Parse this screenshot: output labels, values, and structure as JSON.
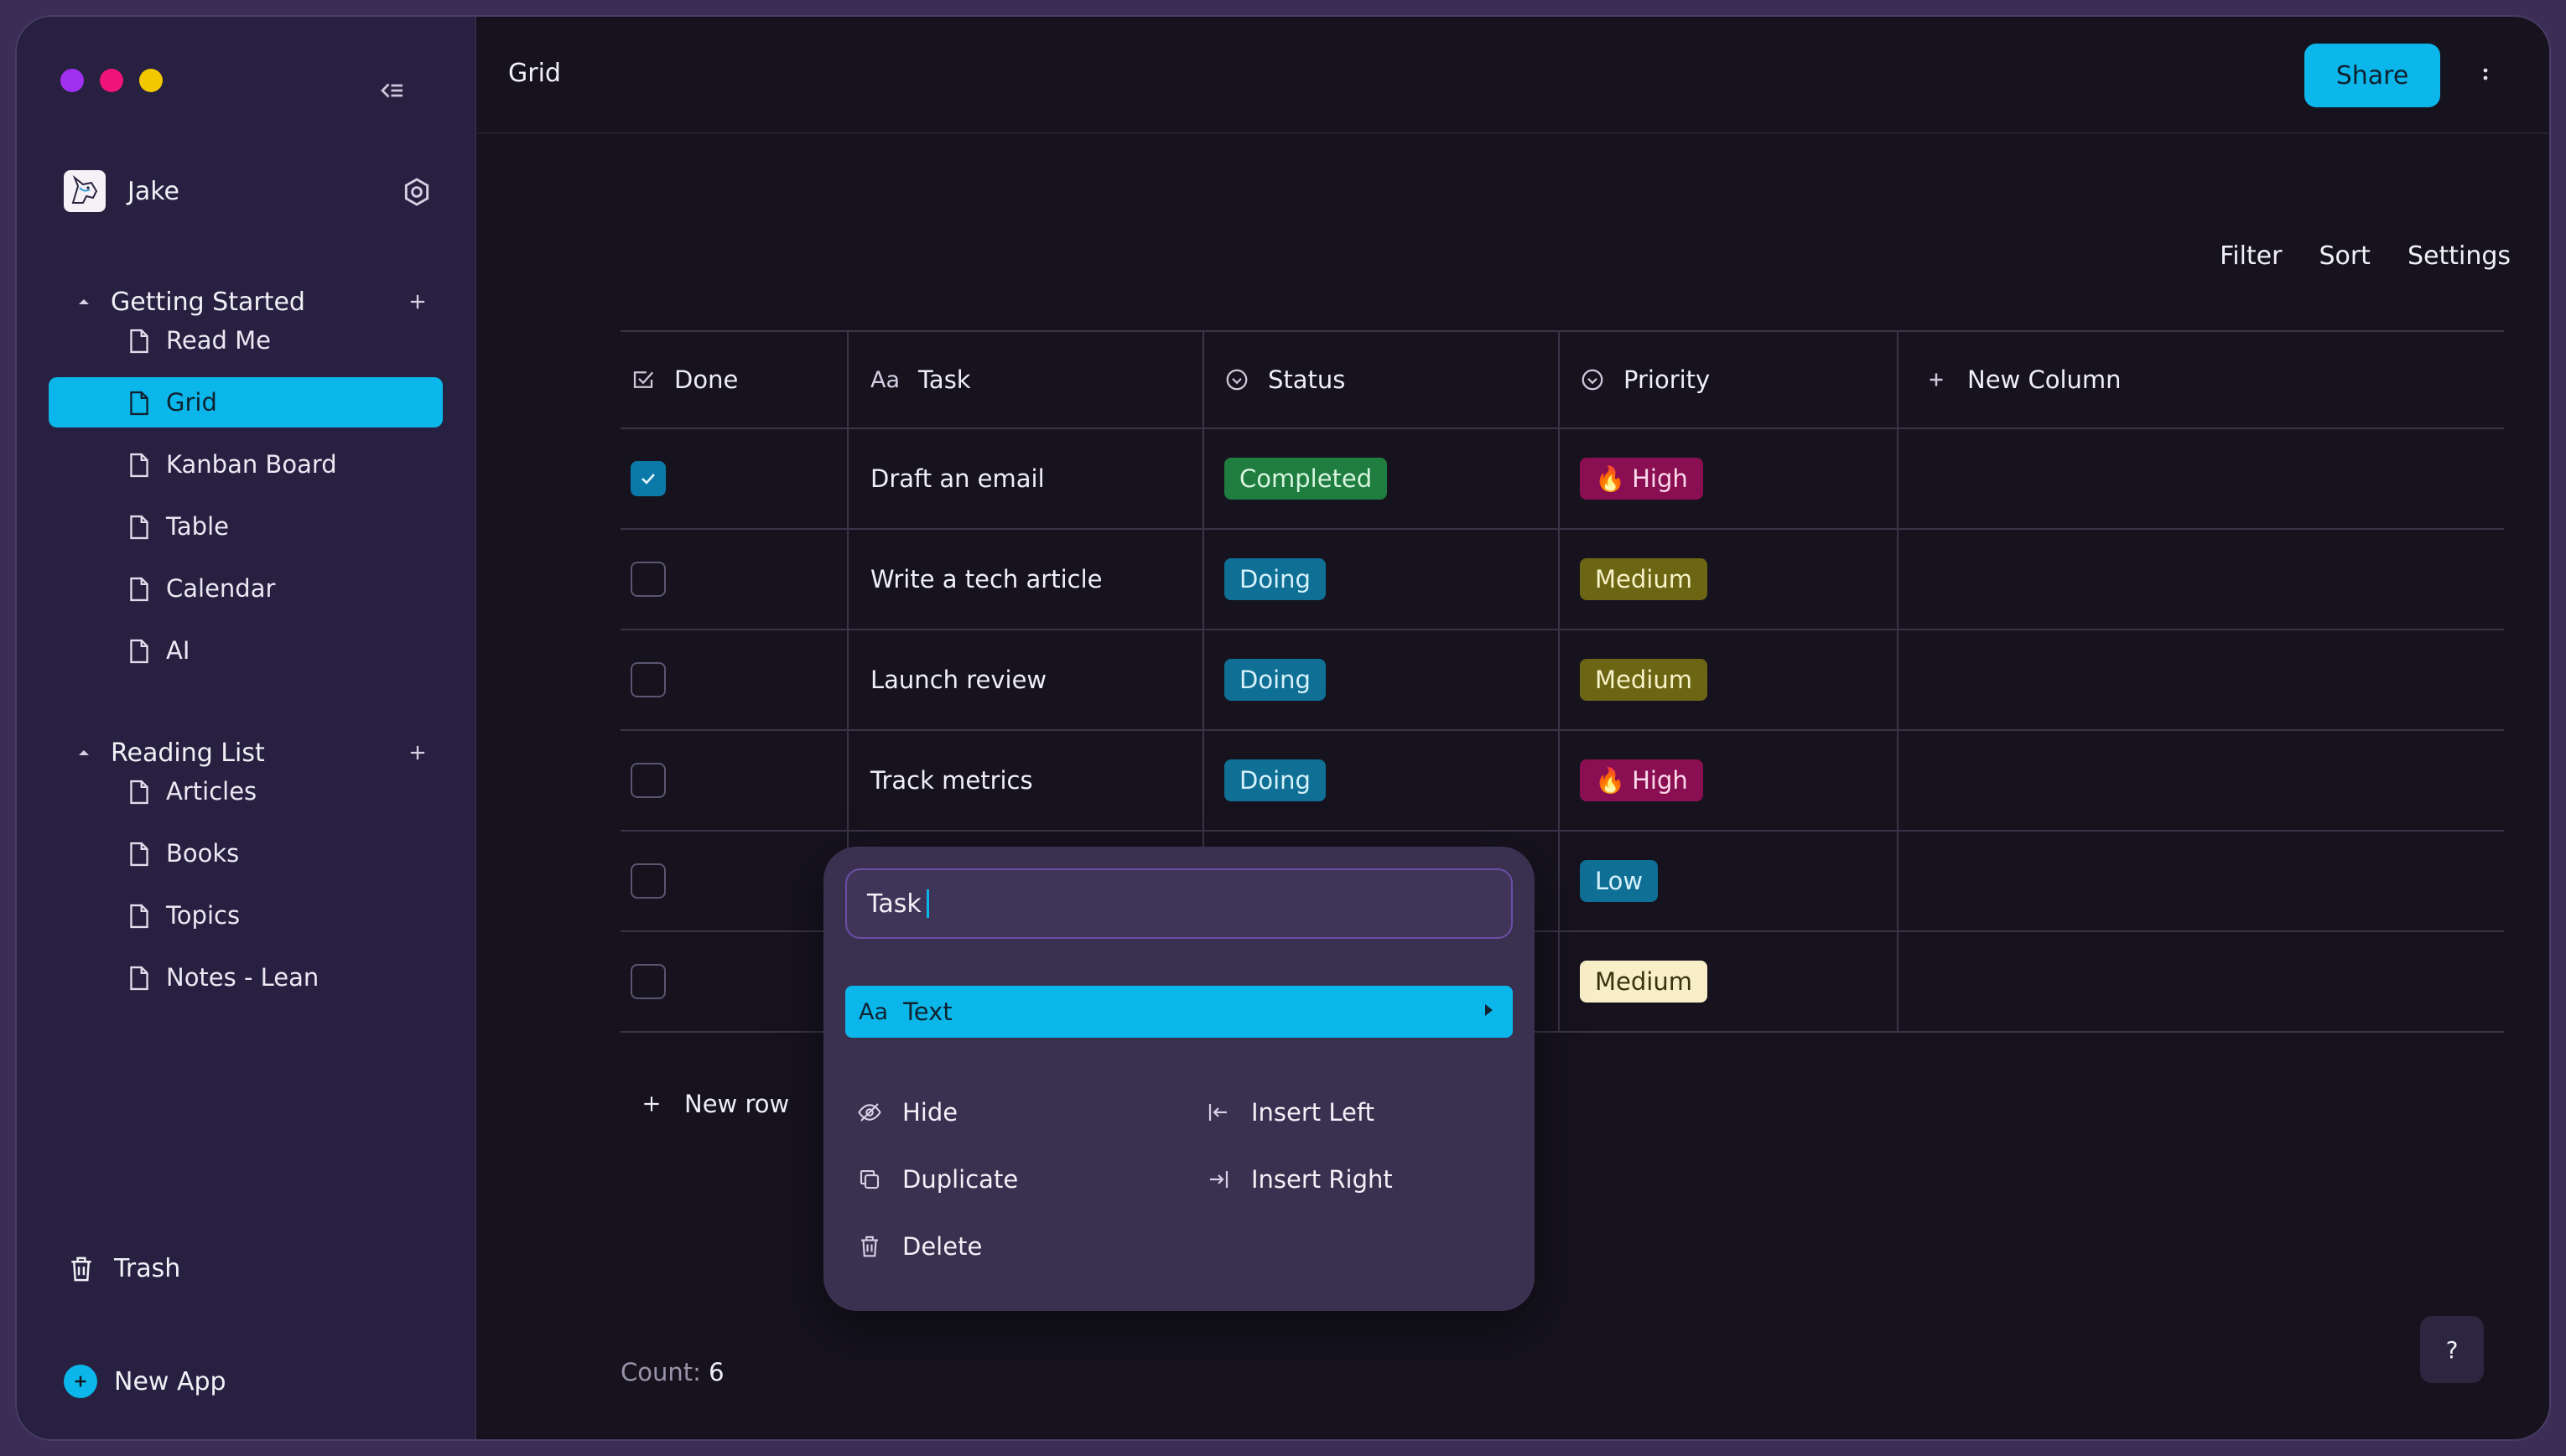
{
  "window": {
    "dot_colors": [
      "#a12ff0",
      "#f0137a",
      "#f2c800"
    ]
  },
  "sidebar": {
    "user_name": "Jake",
    "sections": [
      {
        "label": "Getting Started",
        "items": [
          "Read Me",
          "Grid",
          "Kanban Board",
          "Table",
          "Calendar",
          "AI"
        ]
      },
      {
        "label": "Reading List",
        "items": [
          "Articles",
          "Books",
          "Topics",
          "Notes - Lean"
        ]
      }
    ],
    "active_item": "Grid",
    "trash_label": "Trash",
    "new_app_label": "New App"
  },
  "header": {
    "title": "Grid",
    "share_label": "Share"
  },
  "toolbar": {
    "filter": "Filter",
    "sort": "Sort",
    "settings": "Settings"
  },
  "grid": {
    "columns": {
      "done": "Done",
      "task": "Task",
      "status": "Status",
      "priority": "Priority",
      "new_column": "New Column"
    },
    "task_type_icon": "Aa",
    "rows": [
      {
        "done": true,
        "task": "Draft an email",
        "status": "Completed",
        "priority": "High"
      },
      {
        "done": false,
        "task": "Write a tech article",
        "status": "Doing",
        "priority": "Medium"
      },
      {
        "done": false,
        "task": "Launch review",
        "status": "Doing",
        "priority": "Medium"
      },
      {
        "done": false,
        "task": "Track metrics",
        "status": "Doing",
        "priority": "High"
      },
      {
        "done": false,
        "task": "",
        "status": "",
        "priority": "Low"
      },
      {
        "done": false,
        "task": "",
        "status": "",
        "priority": "Medium"
      }
    ],
    "new_row_label": "New row",
    "count_label": "Count:",
    "count_value": "6"
  },
  "tag_colors": {
    "Completed": {
      "bg": "#1f7d3f",
      "fg": "#d8f5e0"
    },
    "Doing": {
      "bg": "#0f6f94",
      "fg": "#d6f1fb"
    },
    "High": {
      "bg": "#8a0f52",
      "fg": "#fbd9ea"
    },
    "Medium": {
      "bg": "#6b6514",
      "fg": "#f7f3c8"
    },
    "Low": {
      "bg": "#0f6f94",
      "fg": "#d6f1fb"
    },
    "MediumLight": {
      "bg": "#f8efc9",
      "fg": "#3a320f"
    }
  },
  "column_menu": {
    "name_value": "Task",
    "type_icon": "Aa",
    "type_label": "Text",
    "hide": "Hide",
    "duplicate": "Duplicate",
    "delete": "Delete",
    "insert_left": "Insert Left",
    "insert_right": "Insert Right"
  },
  "help_label": "?"
}
